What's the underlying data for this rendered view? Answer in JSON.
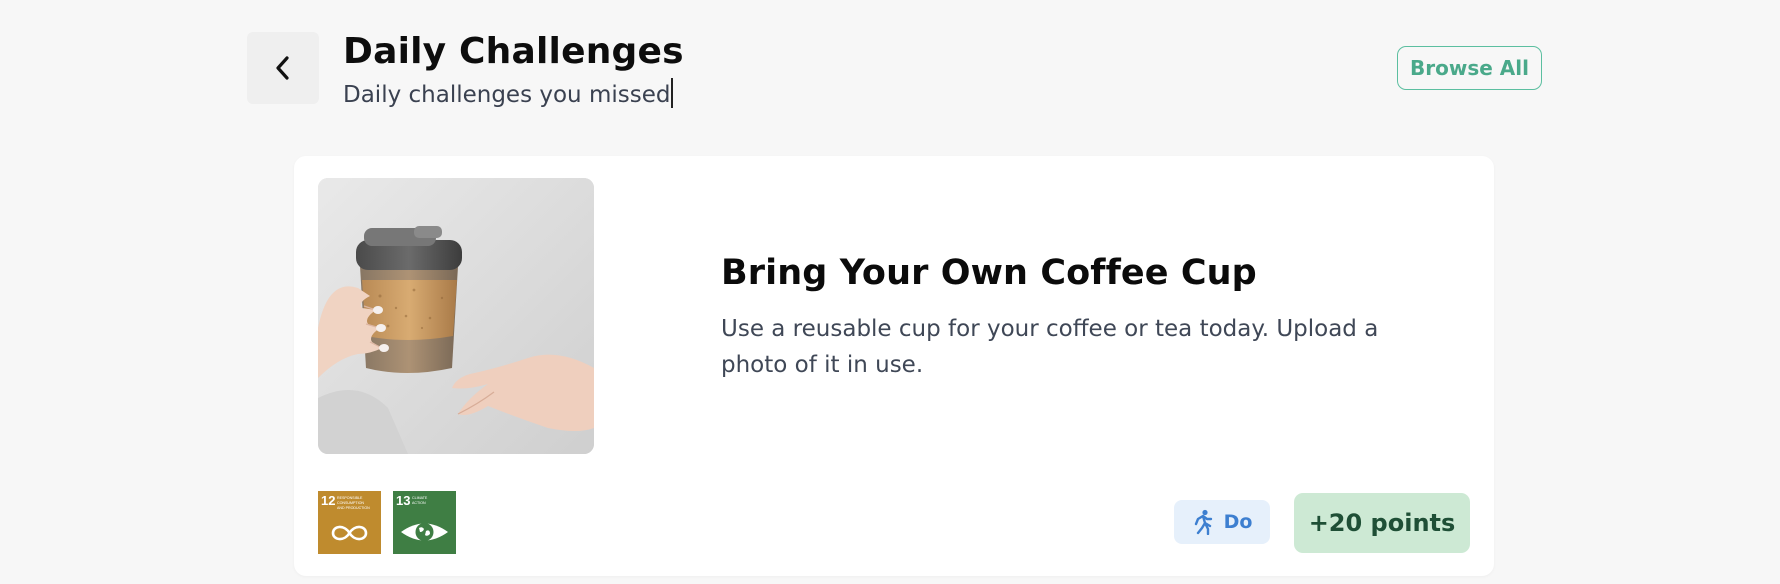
{
  "header": {
    "title": "Daily Challenges",
    "subtitle": "Daily challenges you missed",
    "browse_label": "Browse All",
    "back_icon": "chevron-left-icon"
  },
  "challenge": {
    "image_alt": "Hands holding a reusable glass coffee cup with cork sleeve",
    "title": "Bring Your Own Coffee Cup",
    "description": "Use a reusable cup for your coffee or tea today. Upload a photo of it in use.",
    "sdgs": [
      {
        "number": "12",
        "label_lines": [
          "RESPONSIBLE",
          "CONSUMPTION",
          "AND PRODUCTION"
        ],
        "color": "#bf8b2e",
        "icon": "infinity-icon"
      },
      {
        "number": "13",
        "label_lines": [
          "CLIMATE",
          "ACTION"
        ],
        "color": "#3f7e44",
        "icon": "earth-eye-icon"
      }
    ],
    "action_label": "Do",
    "action_icon": "running-person-icon",
    "points_label": "+20 points"
  },
  "colors": {
    "background": "#f7f7f7",
    "card": "#ffffff",
    "accent_teal": "#4aa98a",
    "do_bg": "#e6f0fb",
    "do_text": "#3d7fd0",
    "points_bg": "#cde9d4",
    "points_text": "#1f4f36"
  }
}
